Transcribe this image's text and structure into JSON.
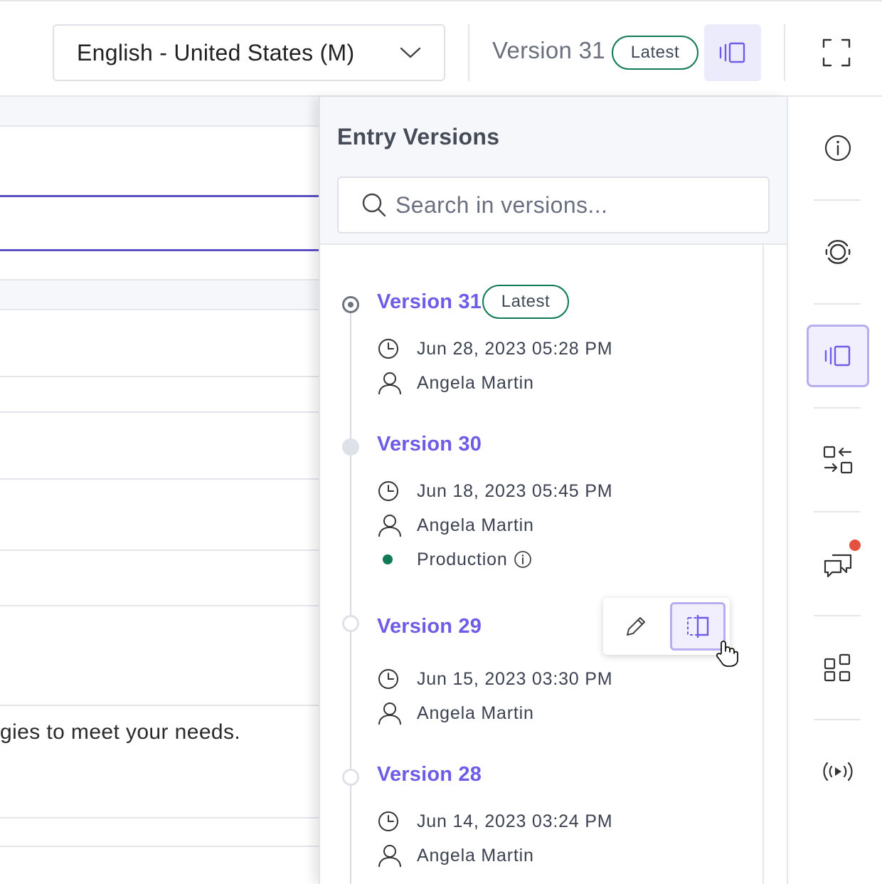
{
  "header": {
    "language_select": {
      "value": "English - United States (M)"
    },
    "version_label": "Version 31",
    "version_badge": "Latest"
  },
  "content": {
    "partial_text": "gies to meet your needs."
  },
  "versions_panel": {
    "title": "Entry Versions",
    "search_placeholder": "Search in versions...",
    "versions": [
      {
        "title": "Version 31",
        "badge": "Latest",
        "date": "Jun 28, 2023 05:28 PM",
        "author": "Angela Martin"
      },
      {
        "title": "Version 30",
        "date": "Jun 18, 2023 05:45 PM",
        "author": "Angela Martin",
        "environment": "Production"
      },
      {
        "title": "Version 29",
        "date": "Jun 15, 2023 03:30 PM",
        "author": "Angela Martin"
      },
      {
        "title": "Version 28",
        "date": "Jun 14, 2023 03:24 PM",
        "author": "Angela Martin"
      }
    ]
  },
  "rail": {
    "items": [
      "info-icon",
      "live-preview-icon",
      "versions-icon",
      "compare-icon",
      "comments-icon",
      "widgets-icon",
      "release-icon"
    ]
  },
  "colors": {
    "accent": "#6c5ce7",
    "badge_border": "#0f7a55",
    "production_dot": "#0f7a55",
    "notification": "#e5513f"
  }
}
